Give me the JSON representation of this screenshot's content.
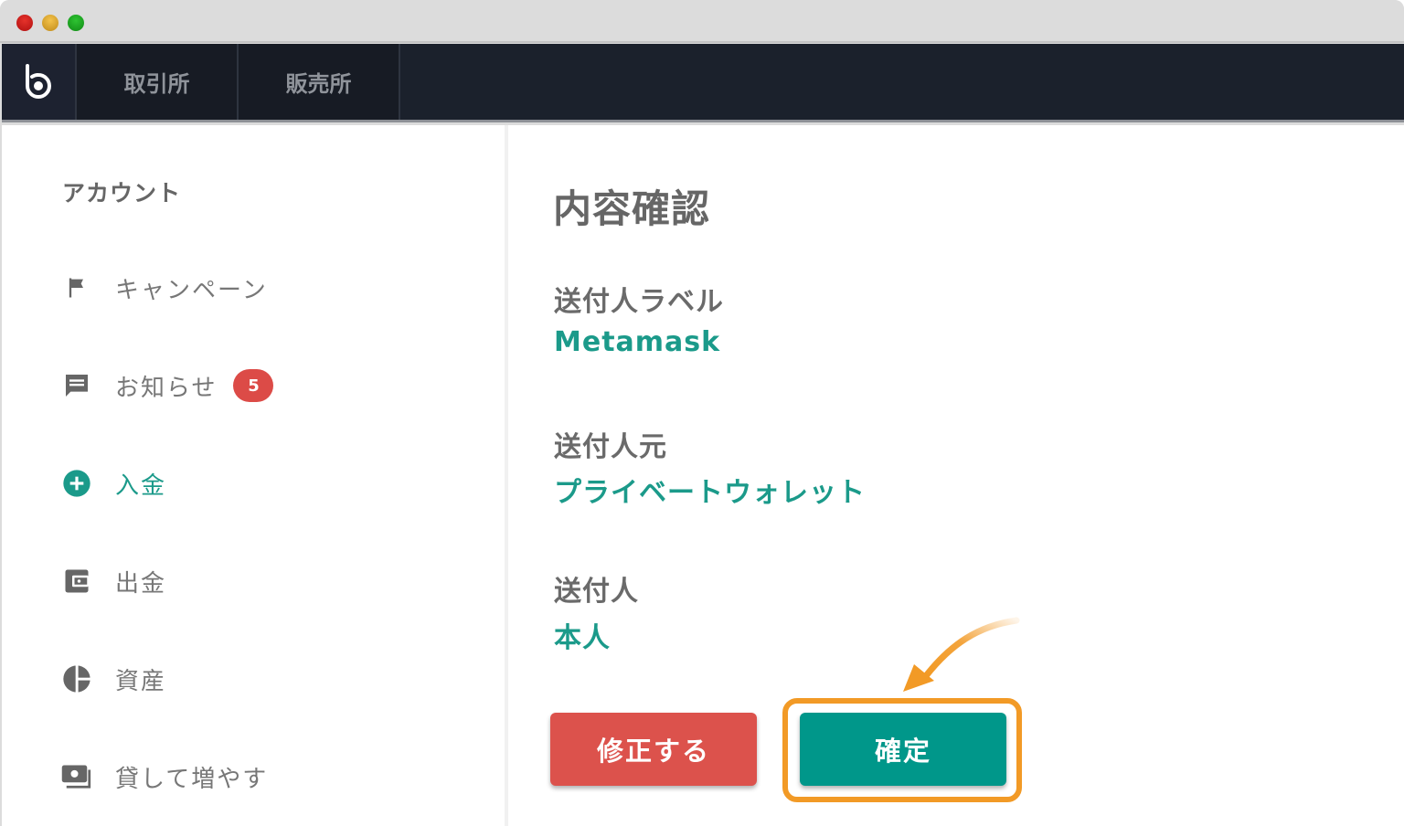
{
  "window": {
    "controls": [
      "close",
      "minimize",
      "maximize"
    ]
  },
  "navbar": {
    "logo_icon": "bitbank-logo-icon",
    "tabs": [
      {
        "label": "取引所"
      },
      {
        "label": "販売所"
      }
    ]
  },
  "sidebar": {
    "heading": "アカウント",
    "items": [
      {
        "label": "キャンペーン",
        "icon": "flag-icon"
      },
      {
        "label": "お知らせ",
        "icon": "message-icon",
        "badge": "5"
      },
      {
        "label": "入金",
        "icon": "plus-circle-icon",
        "active": true
      },
      {
        "label": "出金",
        "icon": "wallet-icon"
      },
      {
        "label": "資産",
        "icon": "pie-chart-icon"
      },
      {
        "label": "貸して増やす",
        "icon": "lend-icon"
      }
    ]
  },
  "main": {
    "title": "内容確認",
    "fields": [
      {
        "label": "送付人ラベル",
        "value": "Metamask"
      },
      {
        "label": "送付人元",
        "value": "プライベートウォレット"
      },
      {
        "label": "送付人",
        "value": "本人"
      }
    ],
    "buttons": {
      "edit": "修正する",
      "confirm": "確定"
    }
  },
  "colors": {
    "accent": "#1b9a8a",
    "confirm": "#00978a",
    "edit": "#dc524c",
    "badge": "#dc4b47",
    "highlight": "#f29a26",
    "navbar": "#1b212c"
  }
}
